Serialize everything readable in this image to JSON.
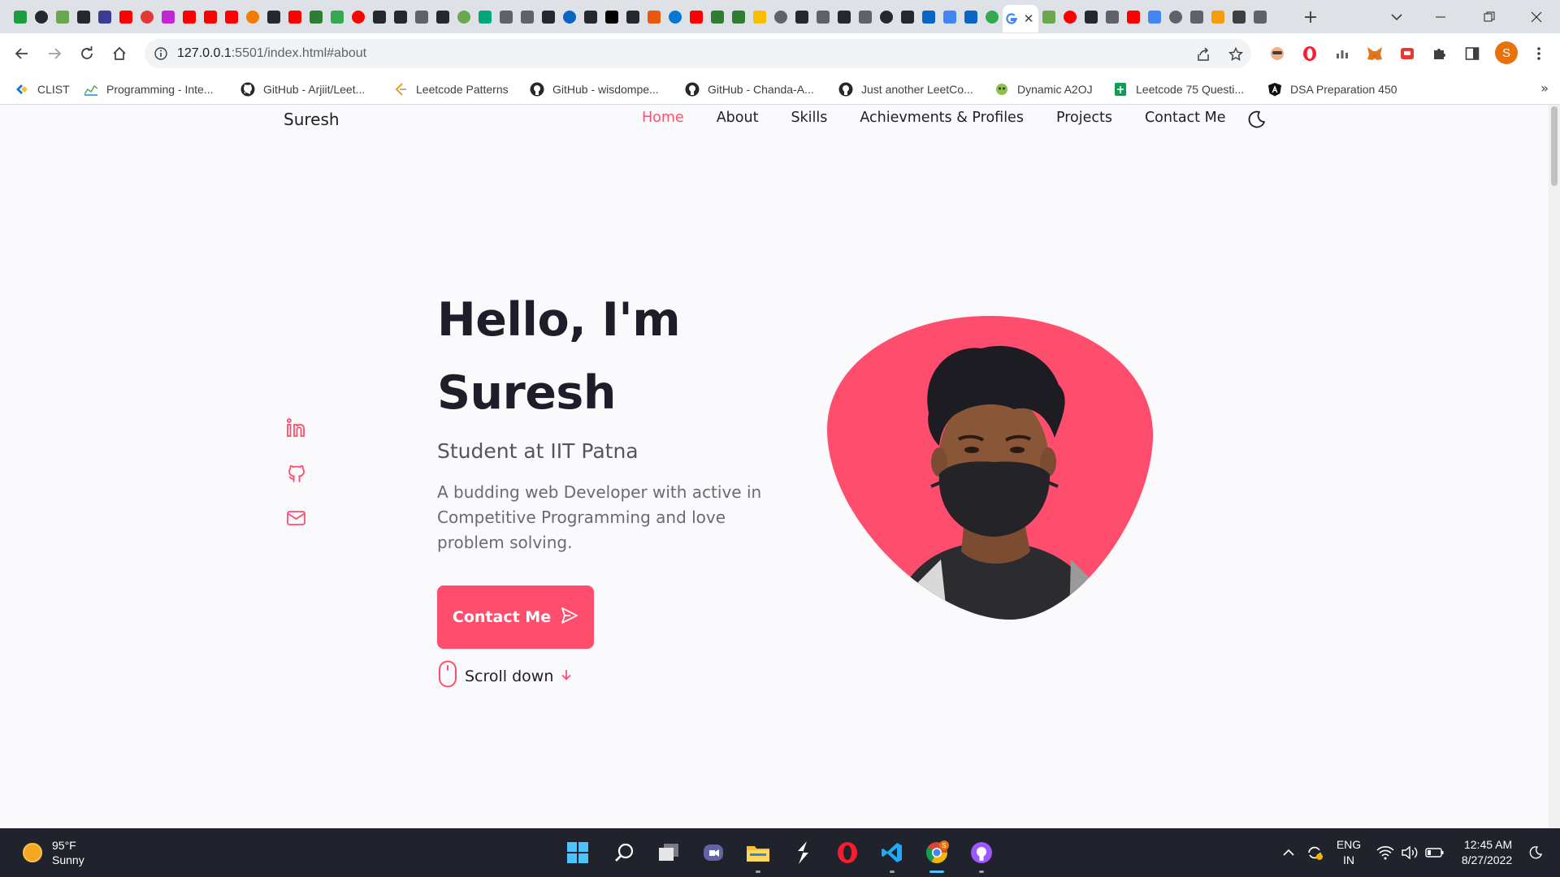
{
  "browser": {
    "tab_favicons": [
      "#1a9e3f",
      "#24292e",
      "#6aa84f",
      "#24292e",
      "#3b3b98",
      "#ff0000",
      "#e53935",
      "#c026d3",
      "#ff0000",
      "#ff0000",
      "#ff0000",
      "#f57c00",
      "#24292e",
      "#ff0000",
      "#2e7d32",
      "#34a853",
      "#ff0000",
      "#24292e",
      "#24292e",
      "#5f6368",
      "#24292e",
      "#6aa84f",
      "#00a67e",
      "#5f6368",
      "#5f6368",
      "#24292e",
      "#0a66c2",
      "#24292e",
      "#000000",
      "#24292e",
      "#ea580c",
      "#0078d4",
      "#ff0000",
      "#2e7d32",
      "#2e7d32",
      "#fbbc04",
      "#5f6368",
      "#24292e",
      "#5f6368",
      "#24292e",
      "#5f6368",
      "#24292e",
      "#24292e",
      "#0a66c2",
      "#4285f4",
      "#0a66c2",
      "#34a853"
    ],
    "tab_favicons_after": [
      "#6aa84f",
      "#ff0000",
      "#24292e",
      "#5f6368",
      "#ff0000",
      "#4285f4",
      "#5f6368",
      "#5f6368",
      "#f59e0b",
      "#3c4043",
      "#5f6368"
    ],
    "active_tab_favicon": "G",
    "address": {
      "host": "127.0.0.1",
      "rest": ":5501/index.html#about"
    },
    "profile_initial": "S",
    "bookmarks": [
      {
        "label": "CLIST",
        "icon": "clist-icon"
      },
      {
        "label": "Programming - Inte...",
        "icon": "chart-icon"
      },
      {
        "label": "GitHub - Arjiit/Leet...",
        "icon": "github-icon"
      },
      {
        "label": "Leetcode Patterns",
        "icon": "leetcode-icon"
      },
      {
        "label": "GitHub - wisdompe...",
        "icon": "github-icon"
      },
      {
        "label": "GitHub - Chanda-A...",
        "icon": "github-icon"
      },
      {
        "label": "Just another LeetCo...",
        "icon": "github-icon"
      },
      {
        "label": "Dynamic A2OJ",
        "icon": "a2oj-icon"
      },
      {
        "label": "Leetcode 75 Questi...",
        "icon": "sheets-icon"
      },
      {
        "label": "DSA Preparation 450",
        "icon": "angular-icon"
      }
    ],
    "bookmarks_more": "»"
  },
  "site": {
    "logo": "Suresh",
    "nav": [
      {
        "label": "Home",
        "active": true
      },
      {
        "label": "About",
        "active": false
      },
      {
        "label": "Skills",
        "active": false
      },
      {
        "label": "Achievments & Profiles",
        "active": false
      },
      {
        "label": "Projects",
        "active": false
      },
      {
        "label": "Contact Me",
        "active": false
      }
    ],
    "hero": {
      "greeting": "Hello, I'm",
      "name": "Suresh",
      "subtitle": "Student at IIT Patna",
      "description": "A budding web Developer with active in Competitive Programming and love problem solving.",
      "cta_label": "Contact Me",
      "scroll_label": "Scroll down"
    },
    "accent": "#ff4d6d"
  },
  "taskbar": {
    "weather_temp": "95°F",
    "weather_desc": "Sunny",
    "lang_top": "ENG",
    "lang_bottom": "IN",
    "time": "12:45 AM",
    "date": "8/27/2022",
    "chrome_badge": "S"
  }
}
